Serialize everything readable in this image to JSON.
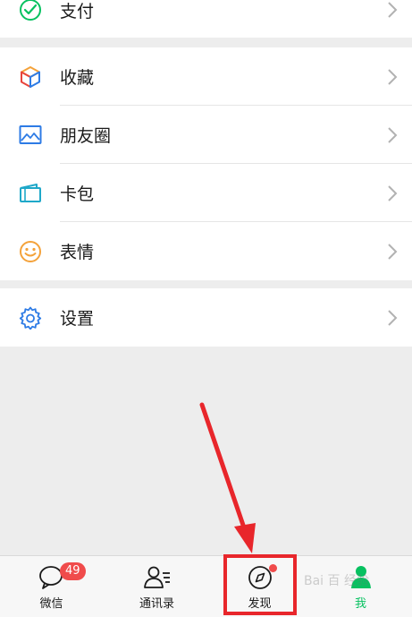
{
  "menu_top": {
    "items": [
      {
        "label": "支付",
        "icon": "payment-icon"
      }
    ]
  },
  "menu_mid": {
    "items": [
      {
        "label": "收藏",
        "icon": "favorites-cube-icon"
      },
      {
        "label": "朋友圈",
        "icon": "moments-picture-icon"
      },
      {
        "label": "卡包",
        "icon": "card-wallet-icon"
      },
      {
        "label": "表情",
        "icon": "smiley-icon"
      }
    ]
  },
  "menu_bottom": {
    "items": [
      {
        "label": "设置",
        "icon": "gear-icon"
      }
    ]
  },
  "tabbar": {
    "tabs": [
      {
        "label": "微信",
        "badge": "49",
        "icon": "chat-bubble-icon"
      },
      {
        "label": "通讯录",
        "icon": "contacts-icon"
      },
      {
        "label": "发现",
        "icon": "compass-icon",
        "has_dot": true
      },
      {
        "label": "我",
        "icon": "person-icon",
        "active": true
      }
    ]
  },
  "watermark": "Bai 百 经验",
  "colors": {
    "accent_green": "#07c160",
    "badge_red": "#f04b4b",
    "annotation_red": "#e8262b",
    "icon_blue": "#2d7be5"
  }
}
